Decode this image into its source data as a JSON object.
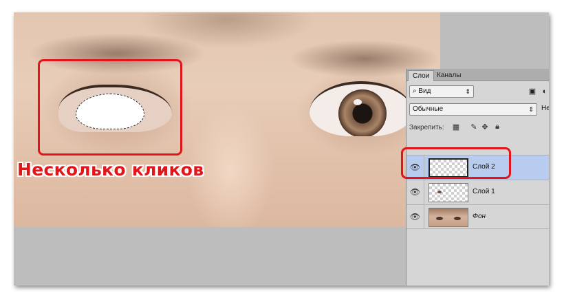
{
  "layers_panel": {
    "tabs": [
      {
        "label": "Слои",
        "active": true
      },
      {
        "label": "Каналы",
        "active": false
      }
    ],
    "filter": {
      "icon": "search-icon",
      "label": "Вид"
    },
    "blend_mode": {
      "label": "Обычные"
    },
    "opacity_label": "Не",
    "lock_label": "Закрепить:",
    "layers": [
      {
        "name": "Слой 2",
        "selected": true,
        "visible": true,
        "thumb": "transparent"
      },
      {
        "name": "Слой 1",
        "selected": false,
        "visible": true,
        "thumb": "transparent"
      },
      {
        "name": "Фон",
        "selected": false,
        "visible": true,
        "thumb": "photo"
      }
    ]
  },
  "annotation": {
    "text": "Несколько кликов",
    "color": "#e0161b"
  },
  "colors": {
    "selection_highlight": "#b7ccee",
    "callout_red": "#e0161b"
  }
}
